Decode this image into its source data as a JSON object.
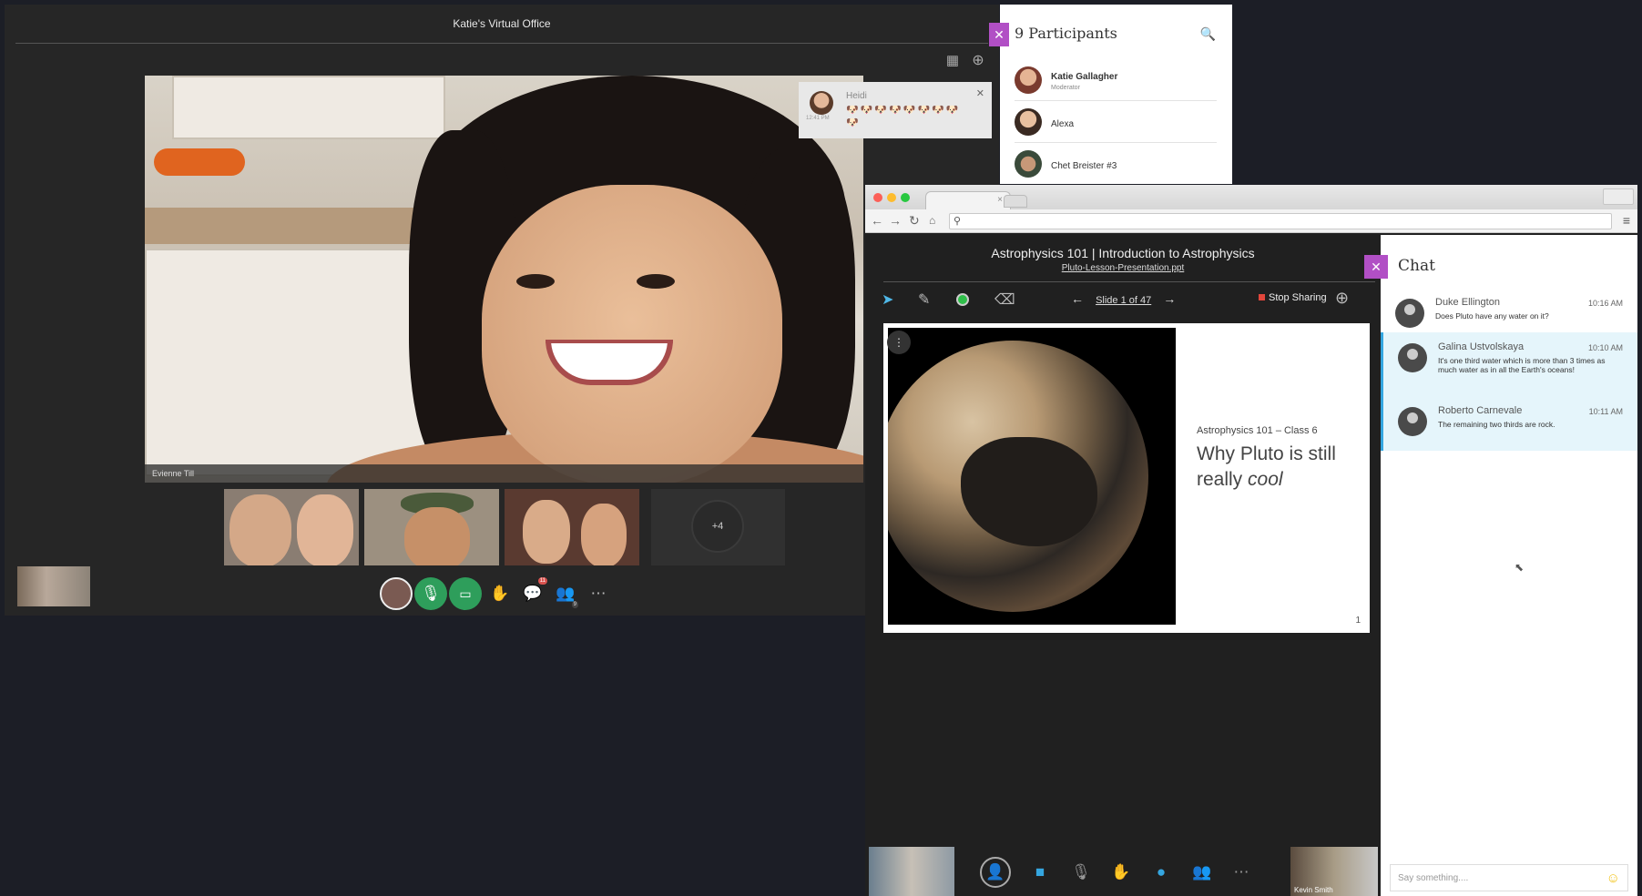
{
  "office": {
    "title": "Katie's Virtual Office",
    "main_video_name": "Evienne Till",
    "more_count": "+4",
    "chat_badge": "11",
    "participants_badge": "9"
  },
  "heidi_card": {
    "name": "Heidi",
    "time": "12:41 PM",
    "emoji": "🐶🐶🐶🐶🐶🐶🐶🐶🐶"
  },
  "participants": {
    "title": "9 Participants",
    "list": [
      {
        "name": "Katie Gallagher",
        "role": "Moderator"
      },
      {
        "name": "Alexa",
        "role": ""
      },
      {
        "name": "Chet Breister #3",
        "role": ""
      }
    ]
  },
  "presentation": {
    "title": "Astrophysics 101 | Introduction to Astrophysics",
    "file": "Pluto-Lesson-Presentation.ppt",
    "slide_nav": "Slide 1 of 47",
    "stop_sharing": "Stop Sharing",
    "slide_class": "Astrophysics 101 – Class 6",
    "slide_head_1": "Why Pluto is still",
    "slide_head_2": "really ",
    "slide_head_em": "cool",
    "slide_number": "1"
  },
  "chat": {
    "title": "Chat",
    "messages": [
      {
        "name": "Duke Ellington",
        "time": "10:16 AM",
        "text": "Does Pluto have any water on it?"
      },
      {
        "name": "Galina Ustvolskaya",
        "time": "10:10 AM",
        "text": "It's one third water which is more than 3 times as much water as in all the Earth's oceans!"
      },
      {
        "name": "Roberto Carnevale",
        "time": "10:11 AM",
        "text": "The remaining two thirds are rock."
      }
    ],
    "input_placeholder": "Say something...."
  },
  "browser_bottom": {
    "right_thumb_name": "Kevin Smith"
  },
  "colors": {
    "accent_purple": "#b14fc5",
    "mic_green": "#2e9e5b",
    "chat_highlight": "#e5f5fb",
    "stop_red": "#e2463b"
  }
}
